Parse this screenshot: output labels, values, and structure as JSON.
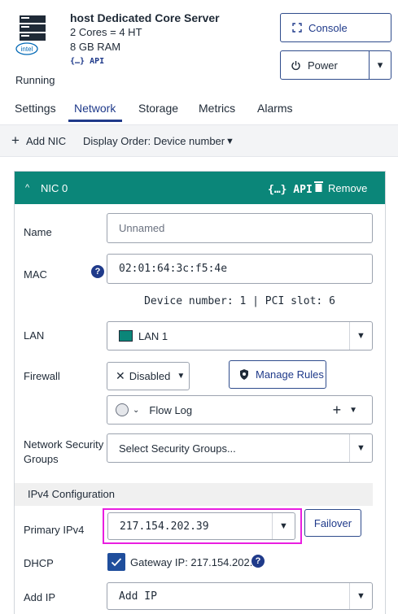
{
  "header": {
    "server_title": "host Dedicated Core Server",
    "cores": "2 Cores = 4 HT",
    "ram": "8 GB RAM",
    "api_label": "{…} API",
    "brand": "intel",
    "status": "Running",
    "console_label": "Console",
    "power_label": "Power"
  },
  "tabs": [
    {
      "label": "Settings"
    },
    {
      "label": "Network"
    },
    {
      "label": "Storage"
    },
    {
      "label": "Metrics"
    },
    {
      "label": "Alarms"
    }
  ],
  "active_tab": "Network",
  "toolbar": {
    "add_nic_label": "Add NIC",
    "display_order_label": "Display Order: Device number"
  },
  "nic": {
    "title": "NIC 0",
    "api_label": "{…} API",
    "remove_label": "Remove",
    "name": {
      "label": "Name",
      "value": "",
      "placeholder": "Unnamed"
    },
    "mac": {
      "label": "MAC",
      "value": "02:01:64:3c:f5:4e"
    },
    "device_info": "Device number: 1 | PCI slot: 6",
    "lan": {
      "label": "LAN",
      "value": "LAN 1"
    },
    "firewall": {
      "label": "Firewall",
      "value": "Disabled",
      "manage_rules_label": "Manage Rules"
    },
    "flow_log": {
      "label": "Flow Log"
    },
    "security_groups": {
      "label": "Network Security Groups",
      "placeholder": "Select Security Groups..."
    },
    "ipv4_section": "IPv4 Configuration",
    "primary_ipv4": {
      "label": "Primary IPv4",
      "value": "217.154.202.39",
      "failover_label": "Failover"
    },
    "dhcp": {
      "label": "DHCP",
      "checked": true,
      "gateway_text": "Gateway IP: 217.154.202.1"
    },
    "add_ip": {
      "label": "Add IP",
      "value": "Add IP"
    }
  },
  "colors": {
    "accent": "#1f3a8a",
    "nic_header": "#0b8679",
    "highlight": "#e91ee0",
    "checkbox": "#1f4e9c"
  }
}
